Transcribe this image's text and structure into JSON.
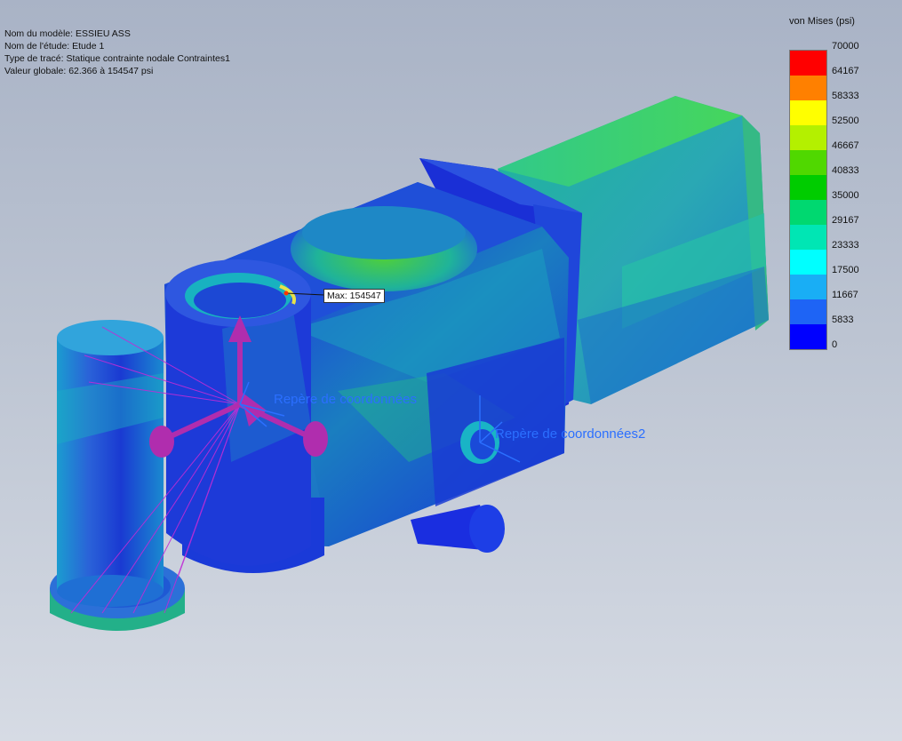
{
  "info": {
    "model_name": "Nom du modèle: ESSIEU ASS",
    "study_name": "Nom de l'étude: Etude 1",
    "plot_type": "Type de tracé: Statique contrainte nodale Contraintes1",
    "global_value": "Valeur globale: 62.366 à 154547 psi"
  },
  "legend": {
    "title": "von Mises (psi)",
    "values": [
      "70000",
      "64167",
      "58333",
      "52500",
      "46667",
      "40833",
      "35000",
      "29167",
      "23333",
      "17500",
      "11667",
      "5833",
      "0"
    ],
    "colors": [
      "#ff0000",
      "#ff8000",
      "#ffff00",
      "#b4f000",
      "#50d800",
      "#00cc00",
      "#00d870",
      "#00e6b4",
      "#00ffff",
      "#19aef5",
      "#1e64f5",
      "#0000ff"
    ]
  },
  "annotations": {
    "max_label": "Max: 154547",
    "coord_label_1": "Repère de coordonnées",
    "coord_label_2": "Repère de coordonnées2"
  }
}
